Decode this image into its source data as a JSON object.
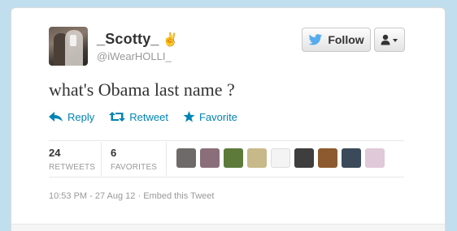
{
  "tweet": {
    "display_name": "_Scotty_",
    "name_emoji": "✌",
    "handle": "@iWearHOLLI_",
    "text": "what's Obama last name ?",
    "follow_label": "Follow",
    "actions": {
      "reply": "Reply",
      "retweet": "Retweet",
      "favorite": "Favorite"
    },
    "stats": {
      "retweets_count": "24",
      "retweets_label": "RETWEETS",
      "favorites_count": "6",
      "favorites_label": "FAVORITES"
    },
    "timestamp": "10:53 PM - 27 Aug 12",
    "separator": " · ",
    "embed_label": "Embed this Tweet"
  },
  "colors": {
    "background": "#c0deed",
    "link": "#0084b4",
    "twitter_blue": "#55acee",
    "muted": "#999999",
    "text": "#333333"
  },
  "avatar_thumbnails": [
    {
      "name": "retweeter-avatar-1",
      "color": "#6e6a6a"
    },
    {
      "name": "retweeter-avatar-2",
      "color": "#8a6f7a"
    },
    {
      "name": "retweeter-avatar-3",
      "color": "#5d7a3a"
    },
    {
      "name": "retweeter-avatar-4",
      "color": "#c8b98a"
    },
    {
      "name": "retweeter-avatar-5",
      "color": "#f4f4f4"
    },
    {
      "name": "retweeter-avatar-6",
      "color": "#3e3e3e"
    },
    {
      "name": "retweeter-avatar-7",
      "color": "#8c5a2e"
    },
    {
      "name": "retweeter-avatar-8",
      "color": "#3a4a5a"
    },
    {
      "name": "retweeter-avatar-9",
      "color": "#e0c9d8"
    }
  ]
}
